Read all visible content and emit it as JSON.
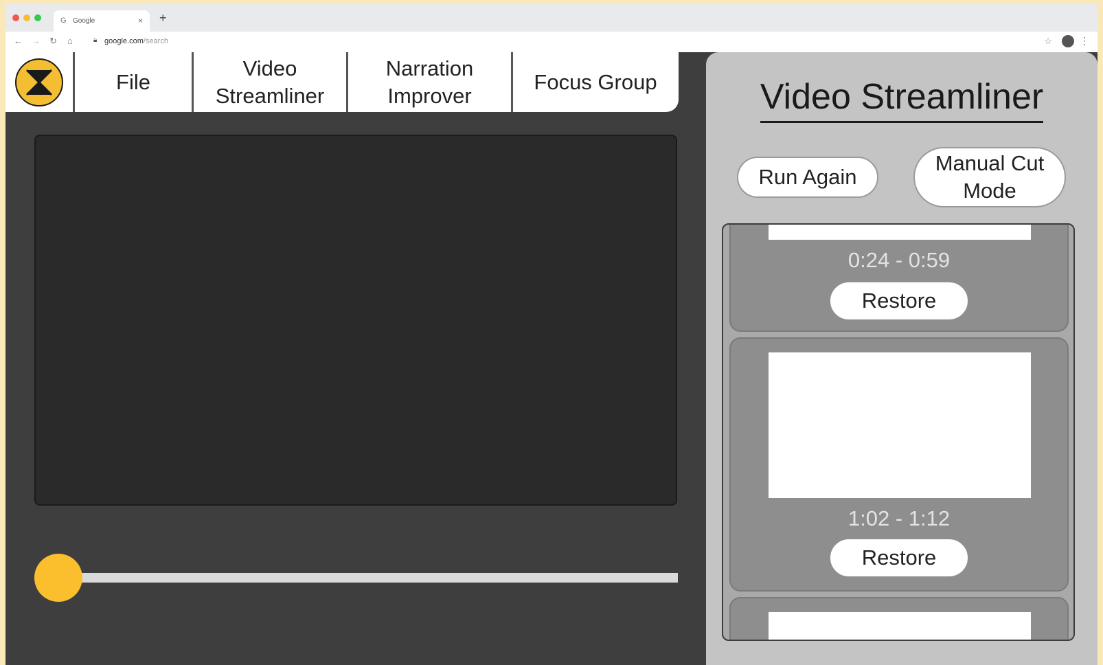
{
  "browser": {
    "tab_title": "Google",
    "url_host": "google.com",
    "url_path": "/search"
  },
  "menu": {
    "items": [
      {
        "label": "File"
      },
      {
        "label": "Video\nStreamliner"
      },
      {
        "label": "Narration\nImprover"
      },
      {
        "label": "Focus Group"
      }
    ]
  },
  "player": {
    "progress": 0
  },
  "panel": {
    "title": "Video Streamliner",
    "run_again_label": "Run Again",
    "manual_cut_label": "Manual Cut\nMode",
    "cuts": [
      {
        "range": "0:24 - 0:59",
        "restore_label": "Restore"
      },
      {
        "range": "1:02 - 1:12",
        "restore_label": "Restore"
      }
    ]
  },
  "colors": {
    "accent": "#fbbf2e",
    "app_bg": "#3e3e3e",
    "panel_bg": "#c4c4c4"
  }
}
